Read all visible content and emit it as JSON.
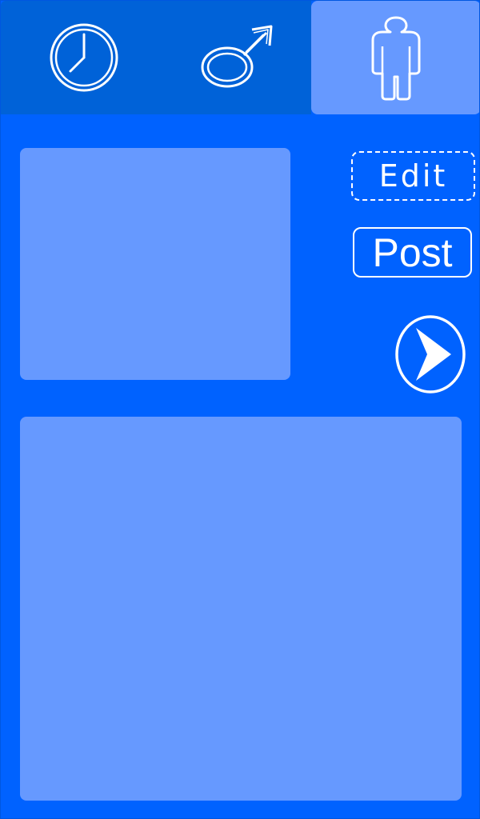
{
  "tabs": [
    {
      "name": "clock",
      "icon": "clock-icon",
      "selected": false
    },
    {
      "name": "gender",
      "icon": "male-symbol-icon",
      "selected": false
    },
    {
      "name": "profile",
      "icon": "person-icon",
      "selected": true
    }
  ],
  "actions": {
    "edit_label": "Edit",
    "post_label": "Post",
    "next_icon": "chevron-right-circle-icon"
  },
  "colors": {
    "background": "#0062ff",
    "tabbar": "#0062d8",
    "panel": "#6699ff",
    "foreground": "#ffffff"
  }
}
